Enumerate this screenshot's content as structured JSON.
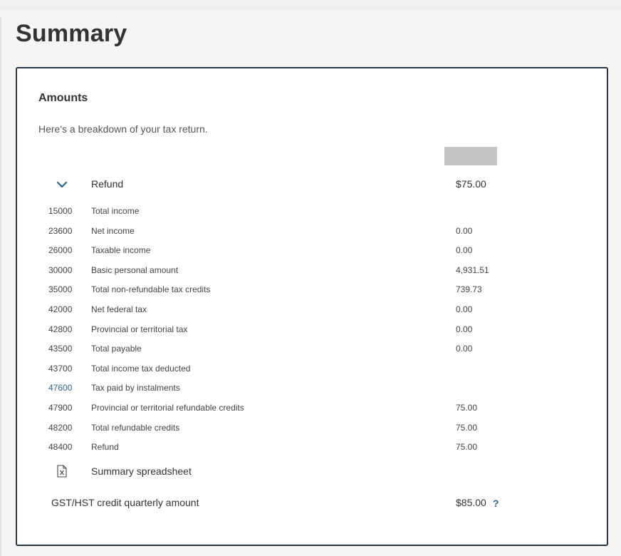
{
  "page": {
    "title": "Summary"
  },
  "card": {
    "heading": "Amounts",
    "intro": "Here's a breakdown of your tax return.",
    "refund": {
      "label": "Refund",
      "amount": "$75.00",
      "toggle_icon": "chevron-down-icon"
    },
    "lines": [
      {
        "code": "15000",
        "description": "Total income",
        "value": "",
        "link": false
      },
      {
        "code": "23600",
        "description": "Net income",
        "value": "0.00",
        "link": false
      },
      {
        "code": "26000",
        "description": "Taxable income",
        "value": "0.00",
        "link": false
      },
      {
        "code": "30000",
        "description": "Basic personal amount",
        "value": "4,931.51",
        "link": false
      },
      {
        "code": "35000",
        "description": "Total non-refundable tax credits",
        "value": "739.73",
        "link": false
      },
      {
        "code": "42000",
        "description": "Net federal tax",
        "value": "0.00",
        "link": false
      },
      {
        "code": "42800",
        "description": "Provincial or territorial tax",
        "value": "0.00",
        "link": false
      },
      {
        "code": "43500",
        "description": "Total payable",
        "value": "0.00",
        "link": false
      },
      {
        "code": "43700",
        "description": "Total income tax deducted",
        "value": "",
        "link": false
      },
      {
        "code": "47600",
        "description": "Tax paid by instalments",
        "value": "",
        "link": true
      },
      {
        "code": "47900",
        "description": "Provincial or territorial refundable credits",
        "value": "75.00",
        "link": false
      },
      {
        "code": "48200",
        "description": "Total refundable credits",
        "value": "75.00",
        "link": false
      },
      {
        "code": "48400",
        "description": "Refund",
        "value": "75.00",
        "link": false
      }
    ],
    "spreadsheet": {
      "label": "Summary spreadsheet",
      "icon": "excel-file-icon"
    },
    "gst": {
      "label": "GST/HST credit quarterly amount",
      "amount": "$85.00",
      "help_text": "?"
    }
  },
  "colors": {
    "card_border": "#26374a",
    "link": "#2b6595",
    "page_background": "#f6f5f3",
    "redaction": "#c4c4c4"
  }
}
